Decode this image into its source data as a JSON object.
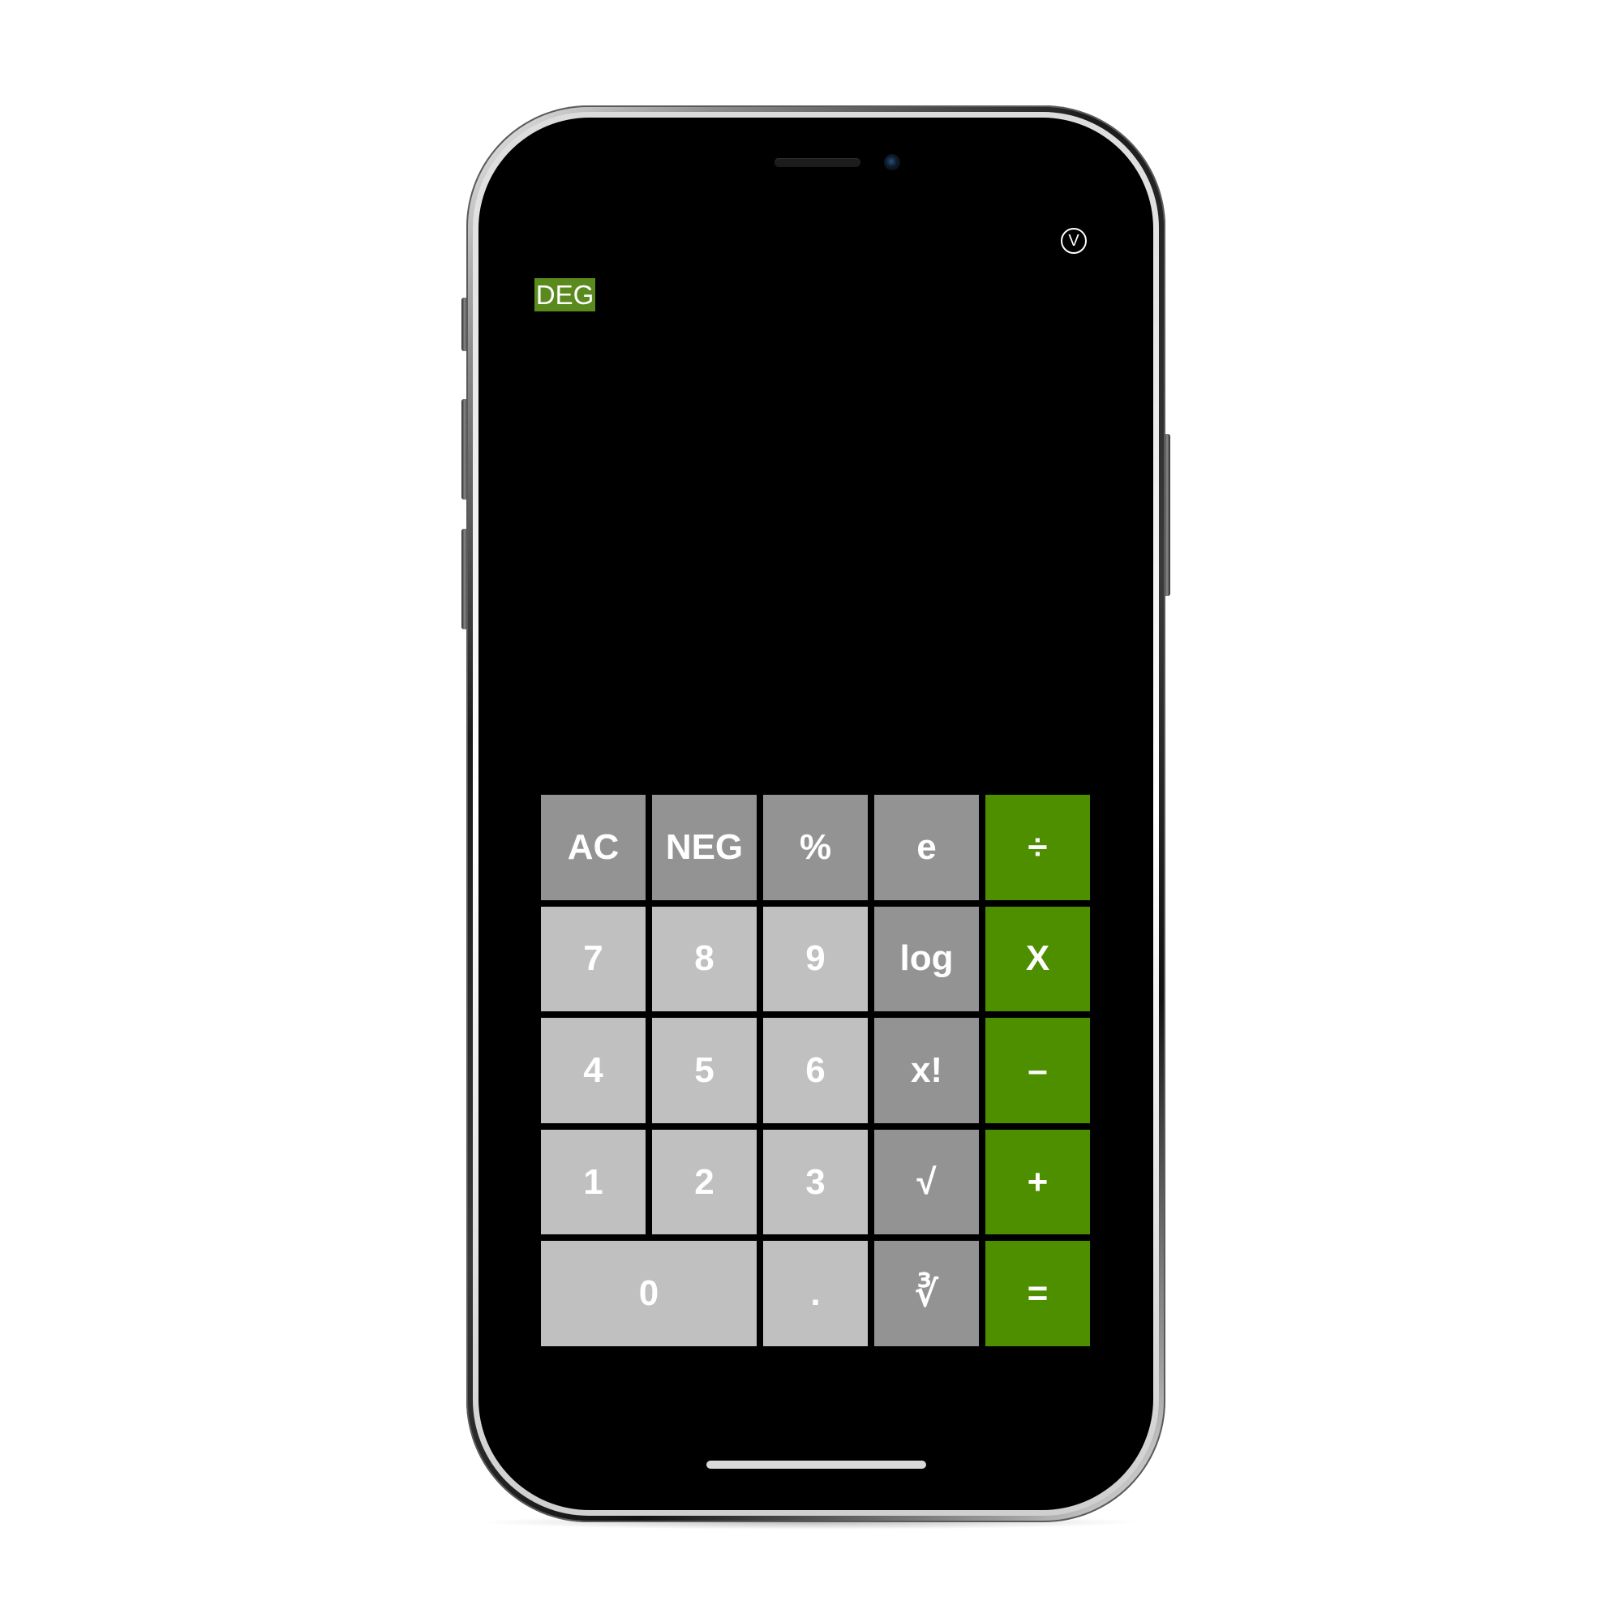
{
  "app": {
    "version_label": "V",
    "angle_mode": "DEG"
  },
  "colors": {
    "operator": "#4e8f00",
    "function": "#939393",
    "number": "#c0c0c0",
    "angle_badge": "#5a8a1e",
    "screen": "#000000"
  },
  "keypad": {
    "row1": {
      "ac": "AC",
      "neg": "NEG",
      "percent": "%",
      "e": "e",
      "divide": "÷"
    },
    "row2": {
      "seven": "7",
      "eight": "8",
      "nine": "9",
      "log": "log",
      "multiply": "X"
    },
    "row3": {
      "four": "4",
      "five": "5",
      "six": "6",
      "factorial": "x!",
      "subtract": "–"
    },
    "row4": {
      "one": "1",
      "two": "2",
      "three": "3",
      "sqrt": "√",
      "add": "+"
    },
    "row5": {
      "zero": "0",
      "decimal": ".",
      "cbrt": "∛",
      "equals": "="
    }
  }
}
